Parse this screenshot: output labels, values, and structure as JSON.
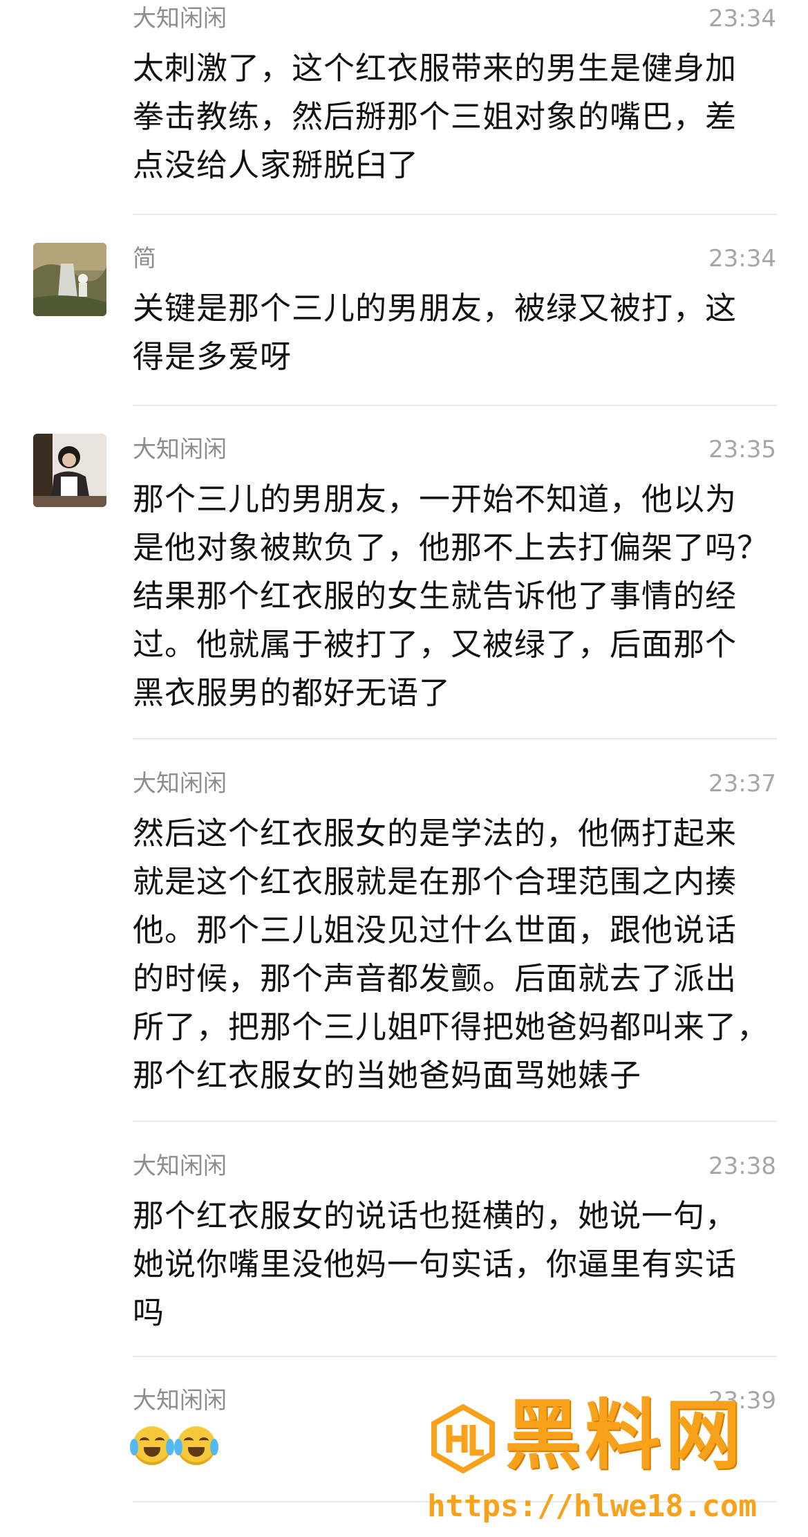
{
  "messages": [
    {
      "name": "大知闲闲",
      "time": "23:34",
      "text": "太刺激了，这个红衣服带来的男生是健身加\n拳击教练，然后掰那个三姐对象的嘴巴，差\n点没给人家掰脱臼了"
    },
    {
      "name": "简",
      "time": "23:34",
      "text": "关键是那个三儿的男朋友，被绿又被打，这\n得是多爱呀"
    },
    {
      "name": "大知闲闲",
      "time": "23:35",
      "text": "那个三儿的男朋友，一开始不知道，他以为\n是他对象被欺负了，他那不上去打偏架了吗？\n结果那个红衣服的女生就告诉他了事情的经\n过。他就属于被打了，又被绿了，后面那个\n黑衣服男的都好无语了"
    },
    {
      "name": "大知闲闲",
      "time": "23:37",
      "text": "然后这个红衣服女的是学法的，他俩打起来\n就是这个红衣服就是在那个合理范围之内揍\n他。那个三儿姐没见过什么世面，跟他说话\n的时候，那个声音都发颤。后面就去了派出\n所了，把那个三儿姐吓得把她爸妈都叫来了，\n那个红衣服女的当她爸妈面骂她婊子"
    },
    {
      "name": "大知闲闲",
      "time": "23:38",
      "text": "那个红衣服女的说话也挺横的，她说一句，\n她说你嘴里没他妈一句实话，你逼里有实话\n吗"
    },
    {
      "name": "大知闲闲",
      "time": "23:39",
      "emojis": [
        "crying-laughing-face-icon",
        "crying-laughing-face-icon"
      ]
    }
  ],
  "watermark": {
    "title": "黑料网",
    "url": "https://hlwe18.com",
    "color": "#f8a21c"
  }
}
